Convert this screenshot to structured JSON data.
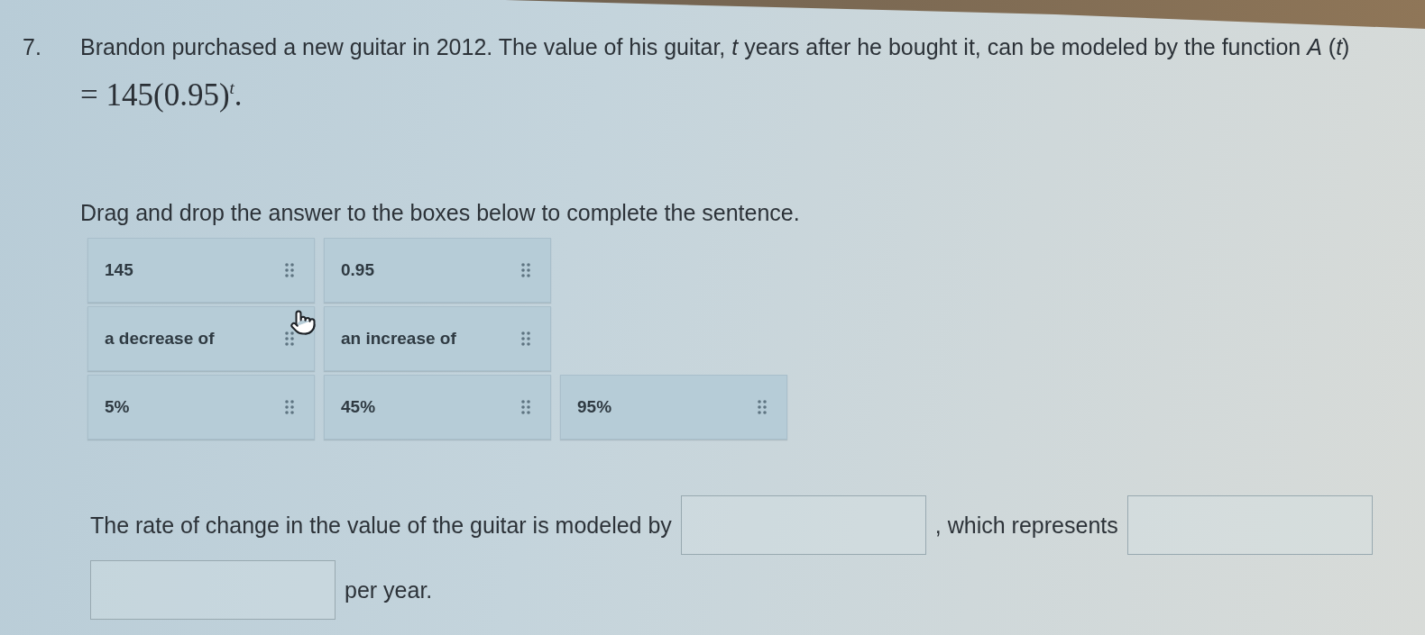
{
  "question": {
    "number": "7.",
    "text": "Brandon purchased a new guitar in 2012. The value of his guitar, *t* years after he bought it, can be modeled by the function *A* (*t*)",
    "formula": "= 145(0.95)$^{t}$."
  },
  "instruction": "Drag and drop the answer to the boxes below to complete the sentence.",
  "tile_rows": [
    {
      "tiles": [
        {
          "label": "145"
        },
        {
          "label": "0.95"
        }
      ]
    },
    {
      "tiles": [
        {
          "label": "a decrease of"
        },
        {
          "label": "an increase of"
        }
      ]
    },
    {
      "tiles": [
        {
          "label": "5%"
        },
        {
          "label": "45%"
        },
        {
          "label": "95%"
        }
      ]
    }
  ],
  "sentence": [
    {
      "kind": "text",
      "text": "The rate of change in the value of the guitar is modeled by"
    },
    {
      "kind": "blank"
    },
    {
      "kind": "text",
      "text": ", which represents"
    },
    {
      "kind": "blank"
    },
    {
      "kind": "blank"
    },
    {
      "kind": "text",
      "text": "per year."
    }
  ]
}
